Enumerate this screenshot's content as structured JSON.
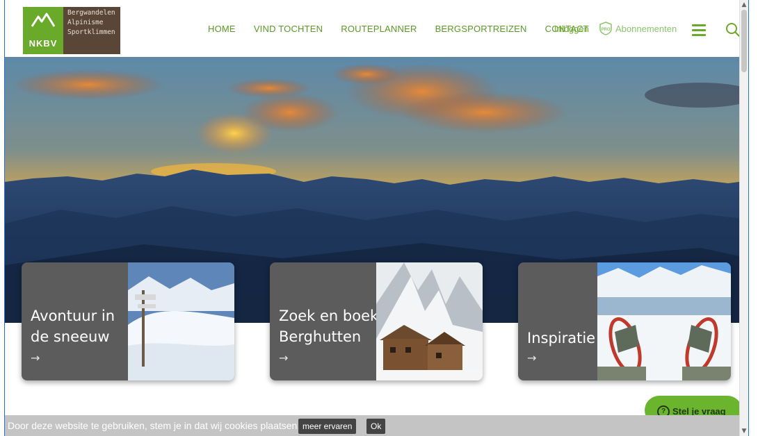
{
  "logo": {
    "abbr": "NKBV",
    "lines": [
      "Bergwandelen",
      "Alpinisme",
      "Sportklimmen"
    ]
  },
  "nav": {
    "items": [
      "HOME",
      "VIND TOCHTEN",
      "ROUTEPLANNER",
      "BERGSPORTREIZEN",
      "CONTACT"
    ],
    "login": "Inloggen",
    "subscriptions": "Abonnementen",
    "pro_badge": "PRO"
  },
  "cards": [
    {
      "label_line1": "Avontuur in",
      "label_line2": "de sneeuw",
      "arrow": "→"
    },
    {
      "label_line1": "Zoek en boek",
      "label_line2": "Berghutten",
      "arrow": "→"
    },
    {
      "label_line1": "Inspiratie",
      "label_line2": "",
      "arrow": "→"
    }
  ],
  "chat": {
    "label": "Stel je vraag"
  },
  "cookie": {
    "message": "Door deze website te gebruiken, stem je in dat wij cookies plaatsen.",
    "more_label": "meer ervaren",
    "ok_label": "Ok"
  },
  "colors": {
    "brand_green": "#6aaa2a",
    "brand_brown": "#5a4636",
    "card_gray": "#5c5c5c"
  }
}
